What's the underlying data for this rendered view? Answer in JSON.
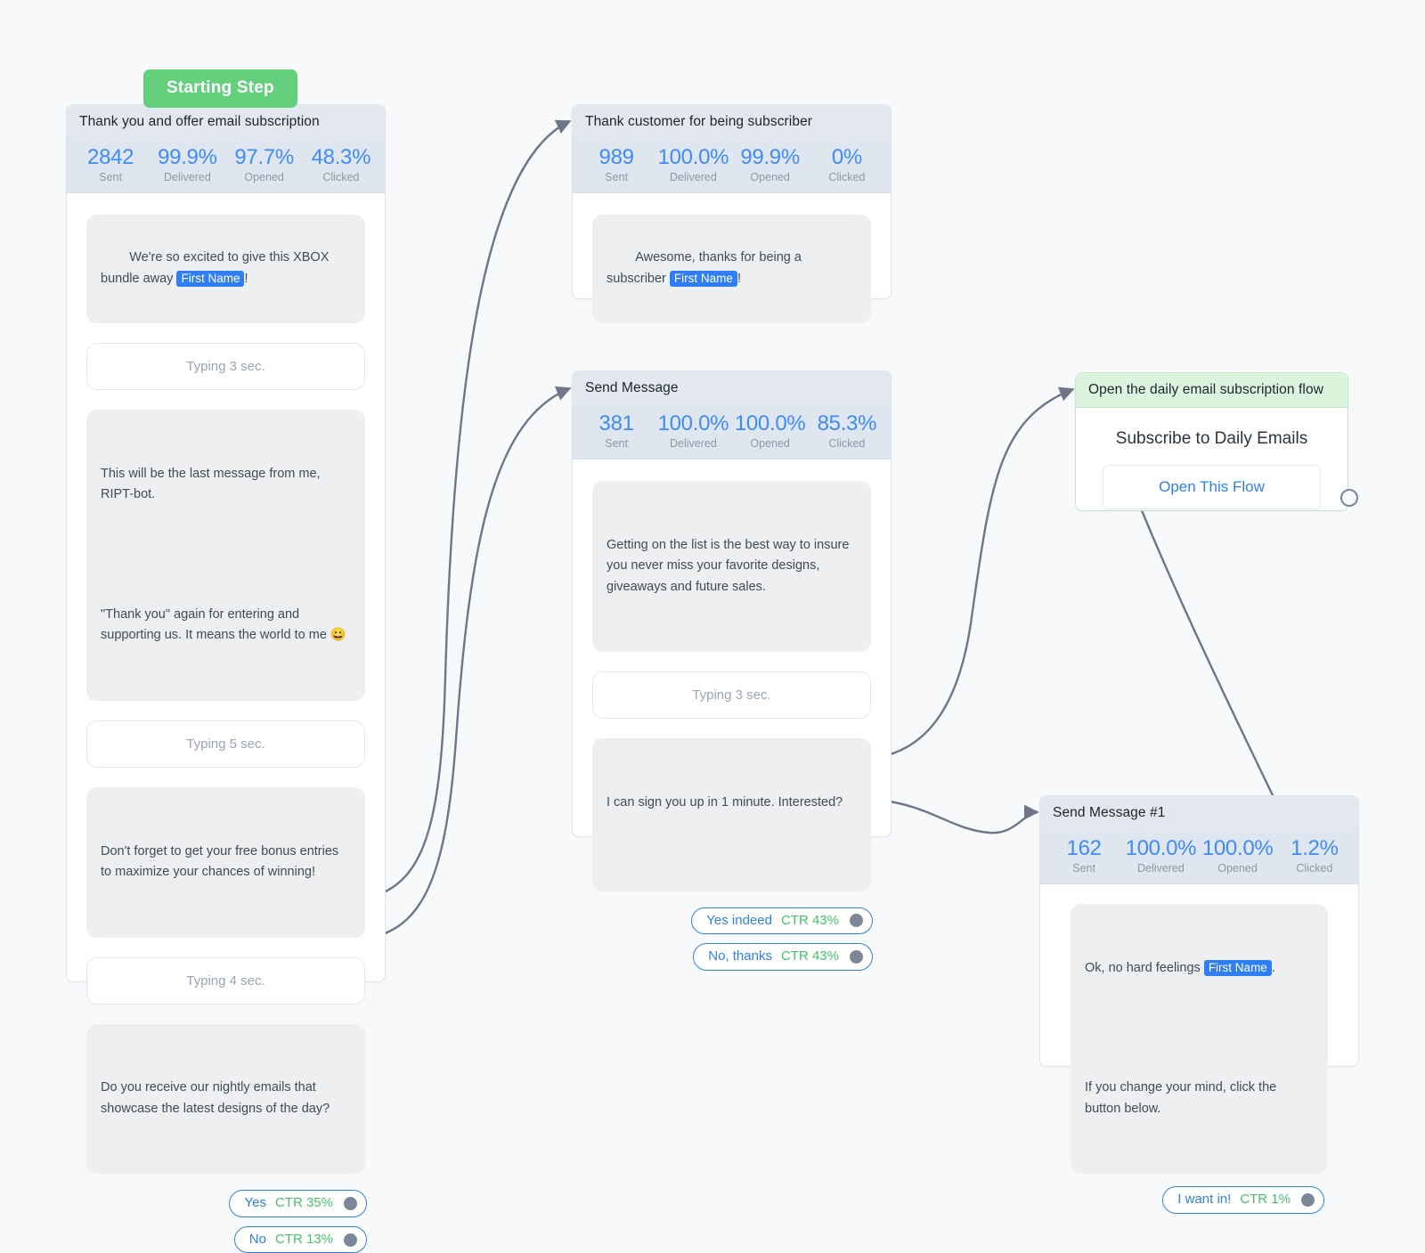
{
  "canvas": {
    "background": "#f7f9fb",
    "accent_blue": "#2f80ed",
    "accent_green": "#49c16b",
    "start_green": "#64d07e"
  },
  "start_pill": {
    "label": "Starting Step"
  },
  "stat_labels": {
    "sent": "Sent",
    "delivered": "Delivered",
    "opened": "Opened",
    "clicked": "Clicked"
  },
  "nodes": [
    {
      "id": "node1",
      "title": "Thank you and offer email subscription",
      "stats": {
        "sent": "2842",
        "delivered": "99.9%",
        "opened": "97.7%",
        "clicked": "48.3%"
      },
      "messages": [
        {
          "kind": "bubble",
          "pre": "We're so excited to give this XBOX bundle away ",
          "token": "First Name",
          "post": "!"
        },
        {
          "kind": "typing",
          "text": "Typing 3 sec."
        },
        {
          "kind": "bubble",
          "p1": "This will be the last message from me, RIPT-bot.",
          "p2": "\"Thank you\" again for entering and supporting us. It means the world to me 😀"
        },
        {
          "kind": "typing",
          "text": "Typing 5 sec."
        },
        {
          "kind": "bubble",
          "p1": "Don't forget to get your free bonus entries to maximize your chances of winning!"
        },
        {
          "kind": "typing",
          "text": "Typing 4 sec."
        },
        {
          "kind": "bubble",
          "p1": "Do you receive our nightly emails that showcase the latest designs of the day?"
        }
      ],
      "buttons": [
        {
          "label": "Yes",
          "ctr": "CTR 35%"
        },
        {
          "label": "No",
          "ctr": "CTR 13%"
        }
      ]
    },
    {
      "id": "node2",
      "title": "Thank customer for being subscriber",
      "stats": {
        "sent": "989",
        "delivered": "100.0%",
        "opened": "99.9%",
        "clicked": "0%"
      },
      "messages": [
        {
          "kind": "bubble",
          "pre": "Awesome, thanks for being a subscriber ",
          "token": "First Name",
          "post": "!"
        }
      ],
      "buttons": []
    },
    {
      "id": "node3",
      "title": "Send Message",
      "stats": {
        "sent": "381",
        "delivered": "100.0%",
        "opened": "100.0%",
        "clicked": "85.3%"
      },
      "messages": [
        {
          "kind": "bubble",
          "p1": "Getting on the list is the best way to insure you never miss your favorite designs, giveaways and future sales."
        },
        {
          "kind": "typing",
          "text": "Typing 3 sec."
        },
        {
          "kind": "bubble",
          "p1": "I can sign you up in 1 minute. Interested?"
        }
      ],
      "buttons": [
        {
          "label": "Yes indeed",
          "ctr": "CTR 43%"
        },
        {
          "label": "No, thanks",
          "ctr": "CTR 43%"
        }
      ]
    },
    {
      "id": "node4",
      "title": "Open the daily email subscription flow",
      "flow_title": "Subscribe to Daily Emails",
      "flow_button": "Open This Flow"
    },
    {
      "id": "node5",
      "title": "Send Message #1",
      "stats": {
        "sent": "162",
        "delivered": "100.0%",
        "opened": "100.0%",
        "clicked": "1.2%"
      },
      "messages": [
        {
          "kind": "bubble",
          "pre": "Ok, no hard feelings ",
          "token": "First Name",
          "post": ".",
          "p2": "If you change your mind, click the button below."
        }
      ],
      "buttons": [
        {
          "label": "I want in!",
          "ctr": "CTR 1%"
        }
      ]
    }
  ]
}
